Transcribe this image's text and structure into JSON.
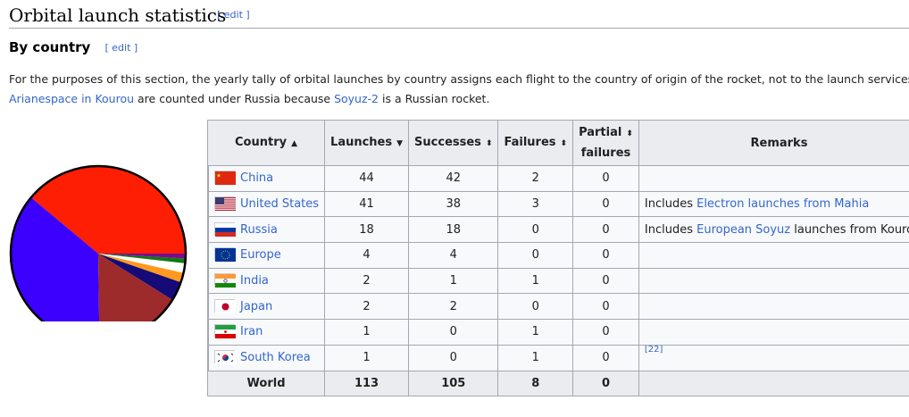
{
  "section": {
    "title": "Orbital launch statistics",
    "edit_label": "[ edit ]"
  },
  "subsection": {
    "title": "By country",
    "edit_label": "[ edit ]"
  },
  "paragraph": {
    "line1": "For the purposes of this section, the yearly tally of orbital launches by country assigns each flight to the country of origin of the rocket, not to the launch services pro",
    "line2_link1": "Arianespace in Kourou",
    "line2_mid": " are counted under Russia because ",
    "line2_link2": "Soyuz-2",
    "line2_end": " is a Russian rocket."
  },
  "table": {
    "headers": {
      "country": "Country",
      "launches": "Launches",
      "successes": "Successes",
      "failures": "Failures",
      "partial_line1": "Partial",
      "partial_line2": "failures",
      "remarks": "Remarks"
    },
    "rows": [
      {
        "country": "China",
        "color": "#fe1e04",
        "flag": "cn-flag-icon",
        "launches": "44",
        "successes": "42",
        "failures": "2",
        "partial": "0",
        "remarks_pre": "",
        "remarks_link": "",
        "remarks_post": ""
      },
      {
        "country": "United States",
        "color": "#3c00ff",
        "flag": "us-flag-icon",
        "launches": "41",
        "successes": "38",
        "failures": "3",
        "partial": "0",
        "remarks_pre": "Includes ",
        "remarks_link": "Electron launches from Mahia",
        "remarks_post": ""
      },
      {
        "country": "Russia",
        "color": "#9e2b2b",
        "flag": "ru-flag-icon",
        "launches": "18",
        "successes": "18",
        "failures": "0",
        "partial": "0",
        "remarks_pre": "Includes ",
        "remarks_link": "European Soyuz",
        "remarks_post": " launches from Kouro"
      },
      {
        "country": "Europe",
        "color": "#140a78",
        "flag": "eu-flag-icon",
        "launches": "4",
        "successes": "4",
        "failures": "0",
        "partial": "0",
        "remarks_pre": "",
        "remarks_link": "",
        "remarks_post": ""
      },
      {
        "country": "India",
        "color": "#ff9a1e",
        "flag": "in-flag-icon",
        "launches": "2",
        "successes": "1",
        "failures": "1",
        "partial": "0",
        "remarks_pre": "",
        "remarks_link": "",
        "remarks_post": ""
      },
      {
        "country": "Japan",
        "color": "#ffffff",
        "flag": "jp-flag-icon",
        "launches": "2",
        "successes": "2",
        "failures": "0",
        "partial": "0",
        "remarks_pre": "",
        "remarks_link": "",
        "remarks_post": ""
      },
      {
        "country": "Iran",
        "color": "#0f7a0f",
        "flag": "ir-flag-icon",
        "launches": "1",
        "successes": "0",
        "failures": "1",
        "partial": "0",
        "remarks_pre": "",
        "remarks_link": "",
        "remarks_post": ""
      },
      {
        "country": "South Korea",
        "color": "#7c0a8f",
        "flag": "kr-flag-icon",
        "launches": "1",
        "successes": "0",
        "failures": "1",
        "partial": "0",
        "remarks_pre": "",
        "remarks_link": "",
        "remarks_post": "",
        "ref": "[22]"
      }
    ],
    "total": {
      "label": "World",
      "launches": "113",
      "successes": "105",
      "failures": "8",
      "partial": "0"
    }
  },
  "chart_data": {
    "type": "pie",
    "categories": [
      "China",
      "United States",
      "Russia",
      "Europe",
      "India",
      "Japan",
      "Iran",
      "South Korea"
    ],
    "values": [
      44,
      41,
      18,
      4,
      2,
      2,
      1,
      1
    ],
    "colors": [
      "#fe1e04",
      "#3c00ff",
      "#9e2b2b",
      "#140a78",
      "#ff9a1e",
      "#ffffff",
      "#0f7a0f",
      "#7c0a8f"
    ]
  }
}
